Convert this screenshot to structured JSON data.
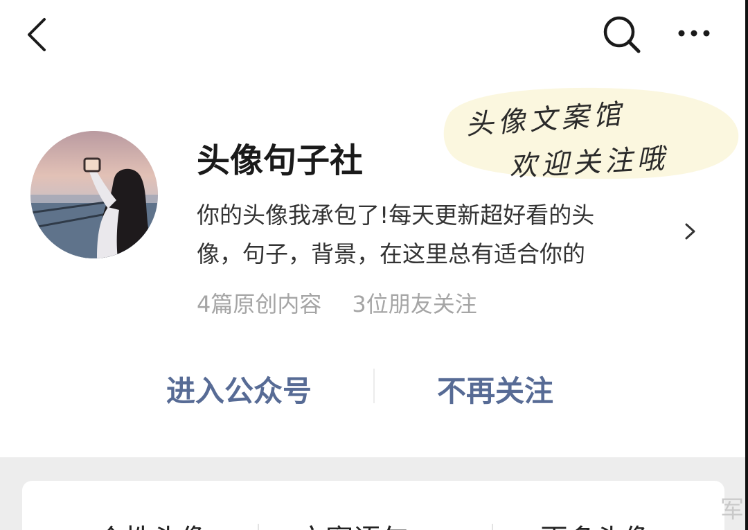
{
  "nav": {
    "back_icon": "chevron-left-icon",
    "search_icon": "search-icon",
    "more_icon": "more-horizontal-icon"
  },
  "sticker": {
    "line1": "头像文案馆",
    "line2": "欢迎关注哦"
  },
  "profile": {
    "name": "头像句子社",
    "bio_line1": "你的头像我承包了!每天更新超好看的头",
    "bio_line2": "像，句子，背景，在这里总有适合你的",
    "original_count": "4篇原创内容",
    "friends_following": "3位朋友关注"
  },
  "actions": {
    "enter_label": "进入公众号",
    "unfollow_label": "不再关注"
  },
  "menu": {
    "tab1": "个性头像",
    "tab2": "文案语句",
    "tab3": "更多头像"
  },
  "watermark": "军",
  "colors": {
    "action_text": "#576b95",
    "name_text": "#1a1a1a",
    "stats_text": "#a5a5a5",
    "sticker_bg": "#fbf6dc"
  }
}
